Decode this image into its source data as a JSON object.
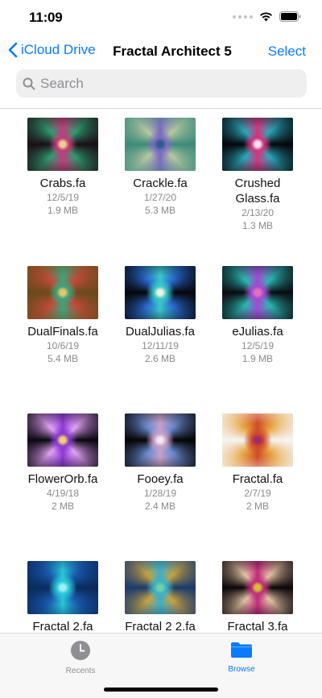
{
  "status": {
    "time": "11:09"
  },
  "nav": {
    "back_label": "iCloud Drive",
    "title": "Fractal Architect 5",
    "select_label": "Select"
  },
  "search": {
    "placeholder": "Search"
  },
  "files": [
    {
      "name": "Crabs.fa",
      "date": "12/5/19",
      "size": "1.9 MB",
      "palette": [
        "#1a0e16",
        "#c23a7a",
        "#2f9a6e",
        "#e8d08a"
      ]
    },
    {
      "name": "Crackle.fa",
      "date": "1/27/20",
      "size": "5.3 MB",
      "palette": [
        "#3d8a7a",
        "#7a6ac2",
        "#b5c9a0",
        "#2b5e8a"
      ]
    },
    {
      "name": "Crushed Glass.fa",
      "date": "2/13/20",
      "size": "1.3 MB",
      "palette": [
        "#05050a",
        "#d2357d",
        "#2aa6b8",
        "#f0e2f0"
      ]
    },
    {
      "name": "DualFinals.fa",
      "date": "10/6/19",
      "size": "5.4 MB",
      "palette": [
        "#6a4a1a",
        "#3aa57a",
        "#c24a3a",
        "#e8c46a"
      ]
    },
    {
      "name": "DualJulias.fa",
      "date": "12/11/19",
      "size": "2.6 MB",
      "palette": [
        "#05060a",
        "#3ac8c8",
        "#2a6ad0",
        "#f0f0e0"
      ]
    },
    {
      "name": "eJulias.fa",
      "date": "12/5/19",
      "size": "1.9 MB",
      "palette": [
        "#0a0a10",
        "#a04ad0",
        "#2ab6b0",
        "#e070c0"
      ]
    },
    {
      "name": "FlowerOrb.fa",
      "date": "4/19/18",
      "size": "2 MB",
      "palette": [
        "#0a0612",
        "#8a3ad0",
        "#e0a0f0",
        "#f0d070"
      ]
    },
    {
      "name": "Fooey.fa",
      "date": "1/28/19",
      "size": "2.4 MB",
      "palette": [
        "#050406",
        "#c8a0c8",
        "#6a8ad0",
        "#f0e8f0"
      ]
    },
    {
      "name": "Fractal.fa",
      "date": "2/7/19",
      "size": "2 MB",
      "palette": [
        "#f5f5f5",
        "#d04a2a",
        "#e8a03a",
        "#a02a6a"
      ]
    },
    {
      "name": "Fractal 2.fa",
      "date": "",
      "size": "",
      "palette": [
        "#0a2a5a",
        "#2ac8d8",
        "#1a5ab0",
        "#a0f0f0"
      ]
    },
    {
      "name": "Fractal 2 2.fa",
      "date": "",
      "size": "",
      "palette": [
        "#1a3a6a",
        "#3ab0c8",
        "#c8a040",
        "#70d0a0"
      ]
    },
    {
      "name": "Fractal 3.fa",
      "date": "",
      "size": "",
      "palette": [
        "#0a0608",
        "#c02a7a",
        "#e0c0a0",
        "#d8c030"
      ]
    }
  ],
  "tabs": [
    {
      "label": "Recents",
      "color": "#8e8e93"
    },
    {
      "label": "Browse",
      "color": "#0a7aff"
    }
  ]
}
